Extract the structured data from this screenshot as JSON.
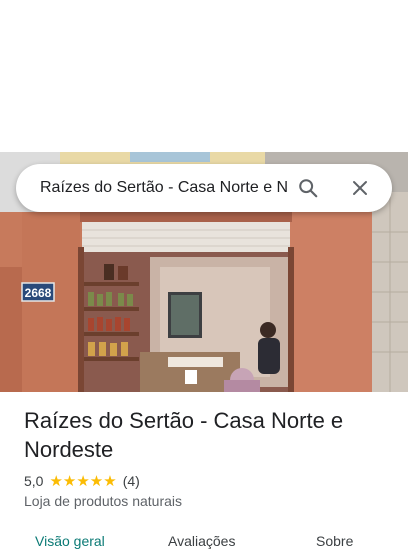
{
  "search": {
    "value": "Raízes do Sertão - Casa Norte e Nordeste",
    "search_icon": "search-icon",
    "close_icon": "close-icon"
  },
  "photo": {
    "house_number": "2668"
  },
  "place": {
    "title": "Raízes do Sertão - Casa Norte e Nordeste",
    "rating": "5,0",
    "stars": "★★★★★",
    "review_count": "(4)",
    "category": "Loja de produtos naturais"
  },
  "tabs": [
    {
      "label": "Visão geral"
    },
    {
      "label": "Avaliações"
    },
    {
      "label": "Sobre"
    }
  ],
  "colors": {
    "accent": "#0b7a75",
    "star": "#fbbc04"
  }
}
